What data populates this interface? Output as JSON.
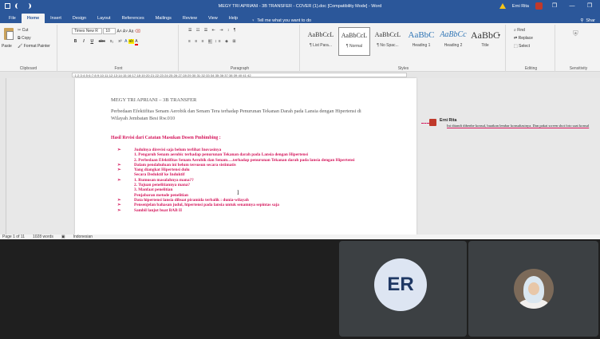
{
  "titlebar": {
    "title": "MEGY TRI APRIANI - 3B TRANSFER - COVER (1).doc [Compatibility Mode] - Word",
    "user": "Erni Rita",
    "window_buttons": [
      "—",
      "❐"
    ]
  },
  "tabs": [
    "File",
    "Home",
    "Insert",
    "Design",
    "Layout",
    "References",
    "Mailings",
    "Review",
    "View",
    "Help"
  ],
  "active_tab": "Home",
  "tell_me": "Tell me what you want to do",
  "share": "Shar",
  "ribbon": {
    "clipboard": {
      "paste": "Paste",
      "cut": "Cut",
      "copy": "Copy",
      "format_painter": "Format Painter",
      "label": "Clipboard"
    },
    "font": {
      "font_name": "Times New R",
      "font_size": "10",
      "label": "Font",
      "bold": "B",
      "italic": "I",
      "underline": "U",
      "strike": "abc",
      "subscript": "x₂",
      "superscript": "x²"
    },
    "paragraph": {
      "label": "Paragraph"
    },
    "styles": {
      "label": "Styles",
      "items": [
        {
          "sample": "AaBbCcL",
          "name": "¶ List Para..."
        },
        {
          "sample": "AaBbCcL",
          "name": "¶ Normal"
        },
        {
          "sample": "AaBbCcL",
          "name": "¶ No Spac..."
        },
        {
          "sample": "AaBbC",
          "name": "Heading 1"
        },
        {
          "sample": "AaBbCc",
          "name": "Heading 2"
        },
        {
          "sample": "AaBbC",
          "name": "Title"
        }
      ]
    },
    "editing": {
      "find": "Find",
      "replace": "Replace",
      "select": "Select",
      "label": "Editing"
    },
    "sensitivity": {
      "label": "Sensitivity"
    }
  },
  "document": {
    "heading": "MEGY TRI APRIANI – 3B TRANSFER",
    "title": "Perbedaan Efektifitas  Senam Aerobik dan Senam Tera terhadap Penurunan Tekanan Darah pada Lansia dengan  Hipertensi di Wilayah Jembatan Besi Rw.010",
    "revision_title": "Hasil Revisi dari Catatan Masukan Dosen Pmbimbing :",
    "revision_items": [
      {
        "text": "Judulnya direvisi saja belum terlihat Inovasinya",
        "bullet": true
      },
      {
        "text": "1.  Pengaruh  Senam  aerobic  terhadap  penurunan  Tekanan  darah  pada  Lansia  dengan Hipertensi",
        "bullet": false
      },
      {
        "text": "2. Perbedaan Efektifitas  Senam Aerobik dan  Senam….terhadap penurunan Tekanan darah pada lansia dengan  Hipertensi",
        "bullet": false
      },
      {
        "text": "Dalam pendahuluan ini belum tersusun secara sistimatis",
        "bullet": true
      },
      {
        "text": "Yang diangkat Hipertensi dulu",
        "bullet": true
      },
      {
        "text": "Secara Deduktif ke Induktif",
        "bullet": false
      },
      {
        "text": "1. Rumusan masalahnya mana??",
        "bullet": true
      },
      {
        "text": "2. Tujuan penelitiannya mana?",
        "bullet": false
      },
      {
        "text": "3. Manfaat penelitian",
        "bullet": false
      },
      {
        "text": "Penjabaran metode penelitian",
        "bullet": false
      },
      {
        "text": "Data hipertensi lansia dibuat piramida terbalik : dunia-wilayah",
        "bullet": true
      },
      {
        "text": "Pensenjelan bahasan judul, hipertensi pada lansia untuk senamnya sepintas saja",
        "bullet": true
      },
      {
        "text": "Sambil lanjut buat BAB II",
        "bullet": true
      }
    ]
  },
  "comment": {
    "author": "Erni Rita",
    "text": "Ini ditandi dibenbe konsul, buatkan lembar konsultasinya. Dan pakai screen shot foto saat konsul"
  },
  "statusbar": {
    "page": "Page 1 of 11",
    "words": "1028 words",
    "language": "Indonesian"
  },
  "meeting": {
    "participant_initials": "ER"
  }
}
